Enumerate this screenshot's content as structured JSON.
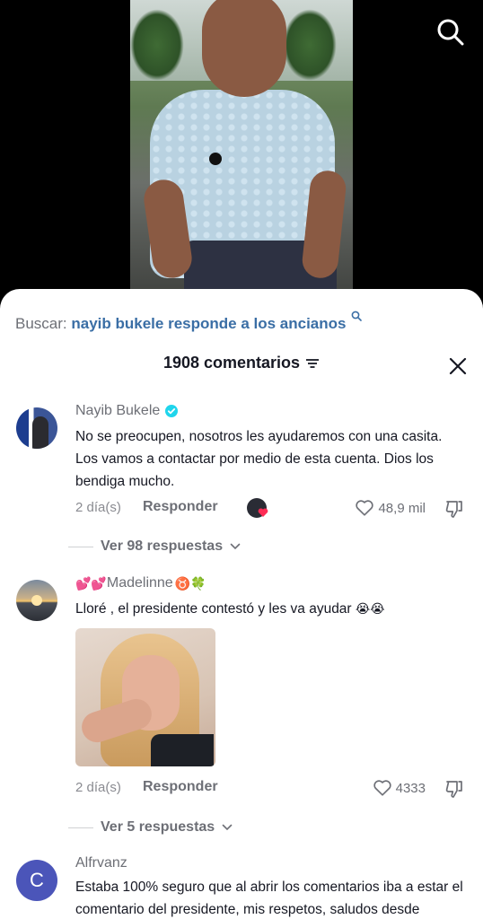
{
  "search_query": {
    "prefix": "Buscar:",
    "query": "nayib bukele responde a los ancianos"
  },
  "header": {
    "count_label": "1908 comentarios"
  },
  "comments": [
    {
      "author": "Nayib Bukele",
      "verified": true,
      "text": "No se preocupen, nosotros les ayudaremos con una casita. Los vamos a contactar por medio de esta cuenta. Dios los bendiga mucho.",
      "time": "2 día(s)",
      "reply_label": "Responder",
      "likes": "48,9 mil",
      "view_replies": "Ver 98 respuestas"
    },
    {
      "author_prefix_emoji": "💕💕",
      "author": "Madelinne",
      "author_suffix_emoji": "♉️🍀",
      "text": "Lloré , el presidente contestó y les va ayudar",
      "text_emoji": "😭😭",
      "time": "2 día(s)",
      "reply_label": "Responder",
      "likes": "4333",
      "view_replies": "Ver 5 respuestas"
    },
    {
      "avatar_letter": "C",
      "author": "Alfrvanz",
      "text": "Estaba 100% seguro que al abrir los comentarios iba a estar el comentario del presidente, mis respetos, saludos desde"
    }
  ]
}
